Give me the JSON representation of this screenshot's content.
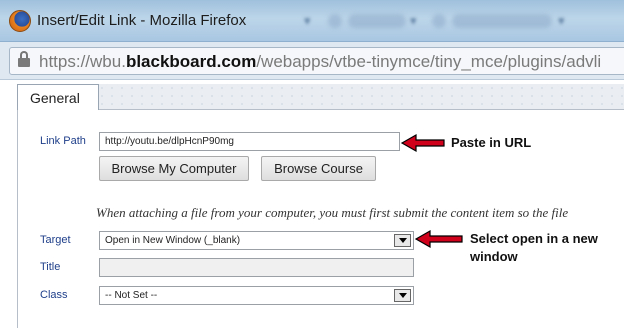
{
  "window": {
    "title": "Insert/Edit Link - Mozilla Firefox",
    "tabs_blurred": [
      "Logins",
      "Bookmarks"
    ]
  },
  "urlbar": {
    "prefix": "https://wbu.",
    "domain": "blackboard.com",
    "path": "/webapps/vtbe-tinymce/tiny_mce/plugins/advli"
  },
  "tabs": [
    {
      "label": "General",
      "active": true
    }
  ],
  "form": {
    "link_path": {
      "label": "Link Path",
      "value": "http://youtu.be/dlpHcnP90mg"
    },
    "browse_computer_label": "Browse My Computer",
    "browse_course_label": "Browse Course",
    "note": "When attaching a file from your computer, you must first submit the content item so the file",
    "target": {
      "label": "Target",
      "selected": "Open in New Window (_blank)"
    },
    "title": {
      "label": "Title",
      "value": ""
    },
    "class": {
      "label": "Class",
      "selected": "-- Not Set --"
    }
  },
  "annotations": {
    "paste_url": "Paste in URL",
    "select_line1": "Select open in a new",
    "select_line2": "window",
    "color": "#d0021b"
  }
}
